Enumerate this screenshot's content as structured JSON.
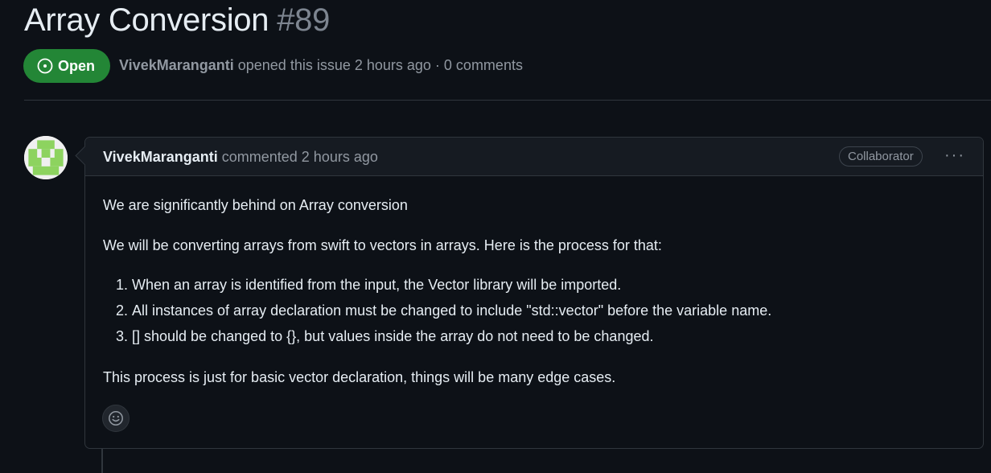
{
  "issue": {
    "title": "Array Conversion",
    "number": "#89",
    "state": "Open",
    "author": "VivekMaranganti",
    "opened_text": "opened this issue 2 hours ago · 0 comments"
  },
  "comment": {
    "author": "VivekMaranganti",
    "action_text": "commented 2 hours ago",
    "role": "Collaborator",
    "more_label": "···",
    "paragraph1": "We are significantly behind on Array conversion",
    "paragraph2": "We will be converting arrays from swift to vectors in arrays. Here is the process for that:",
    "steps": [
      "When an array is identified from the input, the Vector library will be imported.",
      "All instances of array declaration must be changed to include \"std::vector\" before the variable name.",
      "[] should be changed to {}, but values inside the array do not need to be changed."
    ],
    "paragraph3": "This process is just for basic vector declaration, things will be many edge cases."
  },
  "colors": {
    "background": "#0d1117",
    "open_green": "#238636",
    "border": "#30363d",
    "muted_text": "#9198a1"
  },
  "icons": {
    "state": "issue-opened-icon",
    "reaction": "smiley-icon",
    "more": "kebab-horizontal-icon"
  }
}
